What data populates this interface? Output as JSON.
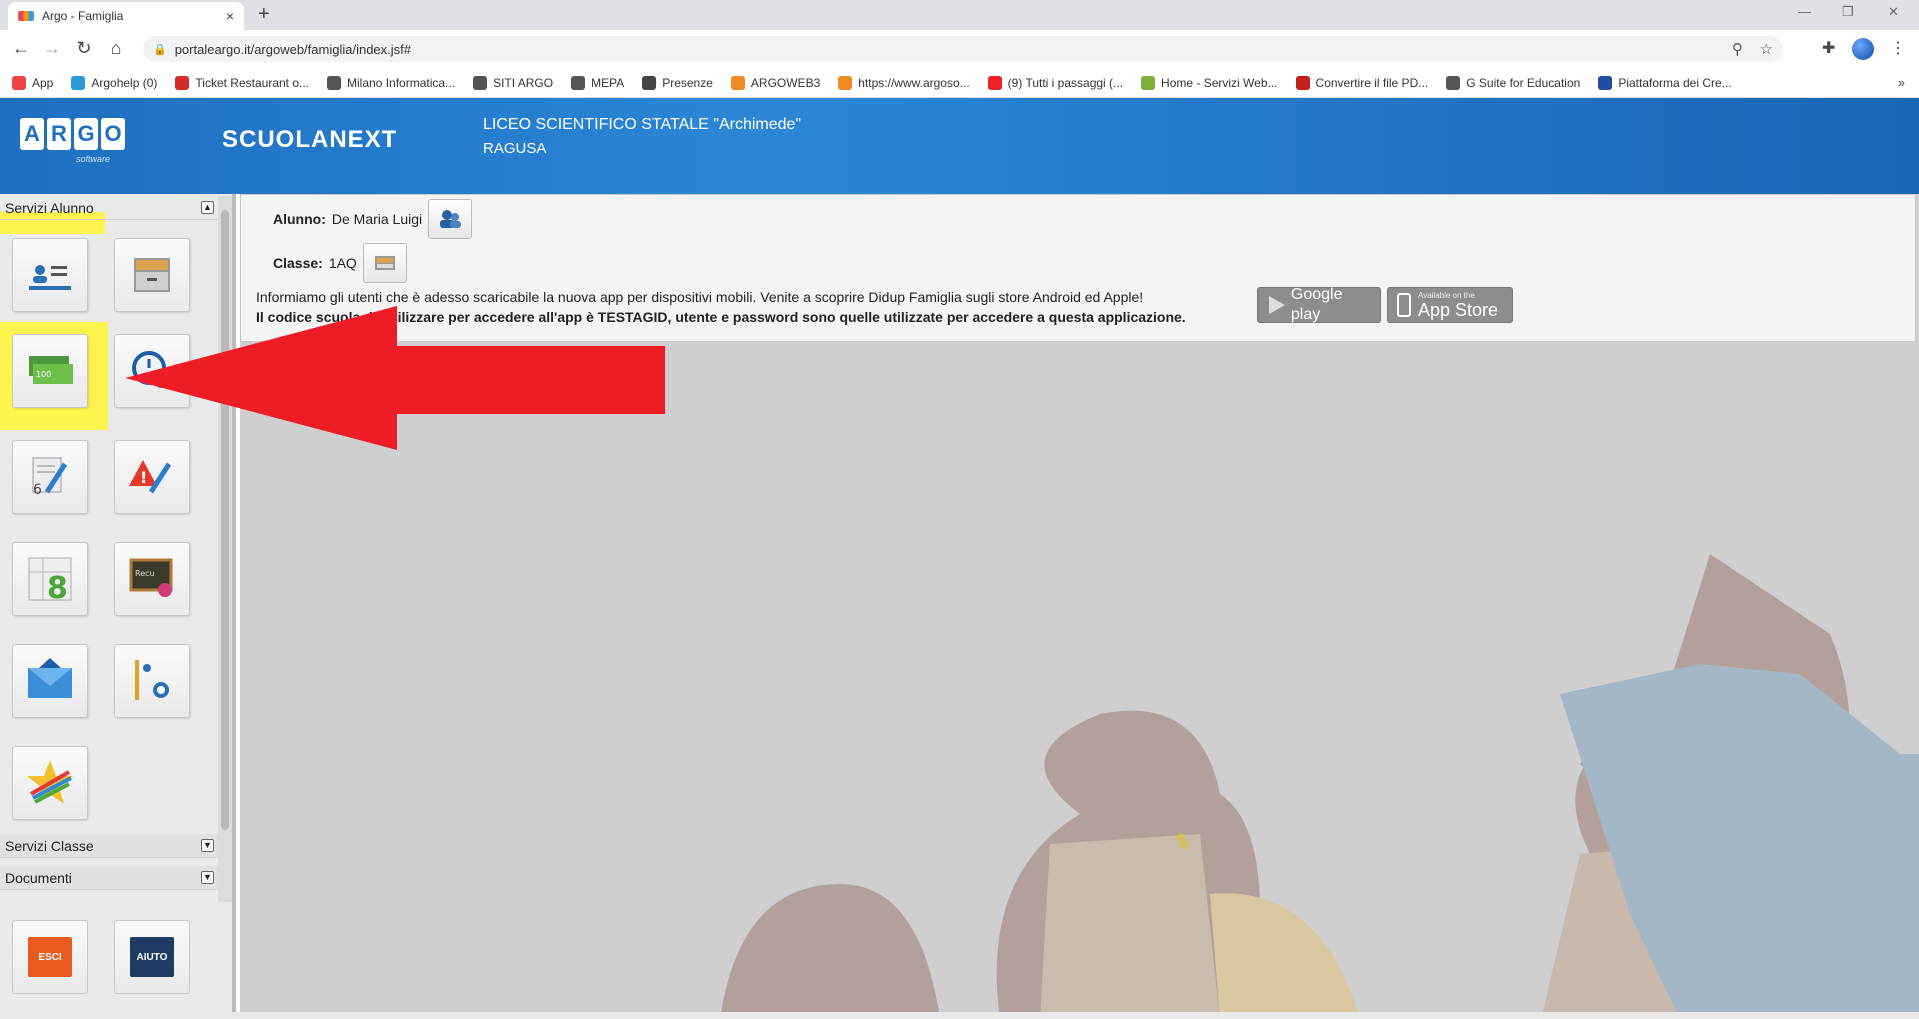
{
  "browser": {
    "tab_title": "Argo - Famiglia",
    "tab_close": "×",
    "new_tab": "+",
    "url": "portaleargo.it/argoweb/famiglia/index.jsf#",
    "bookmarks": [
      {
        "label": "App",
        "color": "#e44"
      },
      {
        "label": "Argohelp (0)",
        "color": "#2a9bd8"
      },
      {
        "label": "Ticket Restaurant o...",
        "color": "#d62b2b"
      },
      {
        "label": "Milano Informatica...",
        "color": "#555555"
      },
      {
        "label": "SITI ARGO",
        "color": "#555555"
      },
      {
        "label": "MEPA",
        "color": "#555555"
      },
      {
        "label": "Presenze",
        "color": "#444444"
      },
      {
        "label": "ARGOWEB3",
        "color": "#f08a24"
      },
      {
        "label": "https://www.argoso...",
        "color": "#f08a24"
      },
      {
        "label": "(9) Tutti i passaggi (...",
        "color": "#ee2222"
      },
      {
        "label": "Home - Servizi Web...",
        "color": "#7bb23a"
      },
      {
        "label": "Convertire il file PD...",
        "color": "#c21f1f"
      },
      {
        "label": "G Suite for Education",
        "color": "#555555"
      },
      {
        "label": "Piattaforma dei Cre...",
        "color": "#1f4ea3"
      }
    ],
    "bookmarks_more": "»"
  },
  "header": {
    "logo_letters": [
      "A",
      "R",
      "G",
      "O"
    ],
    "logo_sub": "software",
    "product": "SCUOLANEXT",
    "school_name": "LICEO SCIENTIFICO STATALE \"Archimede\"",
    "school_city": "RAGUSA"
  },
  "sidebar": {
    "section_student": "Servizi Alunno",
    "section_class": "Servizi Classe",
    "section_docs": "Documenti",
    "exit_label": "ESCI",
    "help_label": "AIUTO"
  },
  "main": {
    "student_label": "Alunno:",
    "student_value": "De Maria Luigi",
    "class_label": "Classe:",
    "class_value": "1AQ",
    "notice_line1": "Informiamo gli utenti che è adesso scaricabile la nuova app per dispositivi mobili. Venite a scoprire Didup Famiglia sugli store Android ed Apple!",
    "notice_line2": "Il codice scuola da utilizzare per accedere all'app è TESTAGID, utente e password sono quelle utilizzate per accedere a questa applicazione.",
    "google_play": "Google play",
    "appstore_small": "Available on the",
    "appstore_big": "App Store"
  },
  "colors": {
    "header_blue": "#1e6fbf",
    "highlight_yellow": "#fff34d",
    "arrow_red": "#ee1c25"
  }
}
